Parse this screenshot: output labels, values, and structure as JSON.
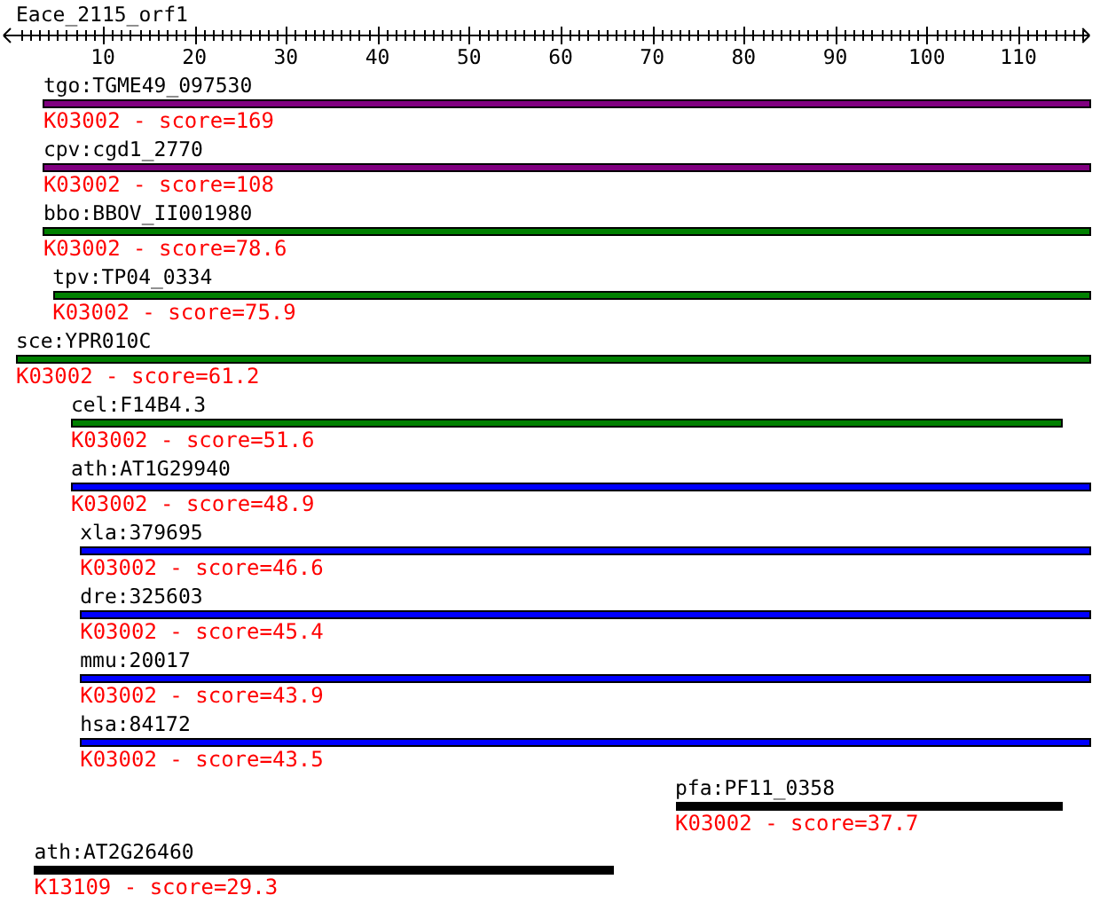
{
  "ruler": {
    "title": "Eace_2115_orf1",
    "ticks": [
      "10",
      "20",
      "30",
      "40",
      "50",
      "60",
      "70",
      "80",
      "90",
      "100",
      "110"
    ]
  },
  "hits": [
    {
      "gene": "tgo:TGME49_097530",
      "score": "K03002 - score=169",
      "color": "#800080"
    },
    {
      "gene": "cpv:cgd1_2770",
      "score": "K03002 - score=108",
      "color": "#800080"
    },
    {
      "gene": "bbo:BBOV_II001980",
      "score": "K03002 - score=78.6",
      "color": "#008000"
    },
    {
      "gene": "tpv:TP04_0334",
      "score": "K03002 - score=75.9",
      "color": "#008000"
    },
    {
      "gene": "sce:YPR010C",
      "score": "K03002 - score=61.2",
      "color": "#008000"
    },
    {
      "gene": "cel:F14B4.3",
      "score": "K03002 - score=51.6",
      "color": "#008000"
    },
    {
      "gene": "ath:AT1G29940",
      "score": "K03002 - score=48.9",
      "color": "#0000ff"
    },
    {
      "gene": "xla:379695",
      "score": "K03002 - score=46.6",
      "color": "#0000ff"
    },
    {
      "gene": "dre:325603",
      "score": "K03002 - score=45.4",
      "color": "#0000ff"
    },
    {
      "gene": "mmu:20017",
      "score": "K03002 - score=43.9",
      "color": "#0000ff"
    },
    {
      "gene": "hsa:84172",
      "score": "K03002 - score=43.5",
      "color": "#0000ff"
    },
    {
      "gene": "pfa:PF11_0358",
      "score": "K03002 - score=37.7",
      "color": "#000000"
    },
    {
      "gene": "ath:AT2G26460",
      "score": "K13109 - score=29.3",
      "color": "#000000"
    }
  ]
}
